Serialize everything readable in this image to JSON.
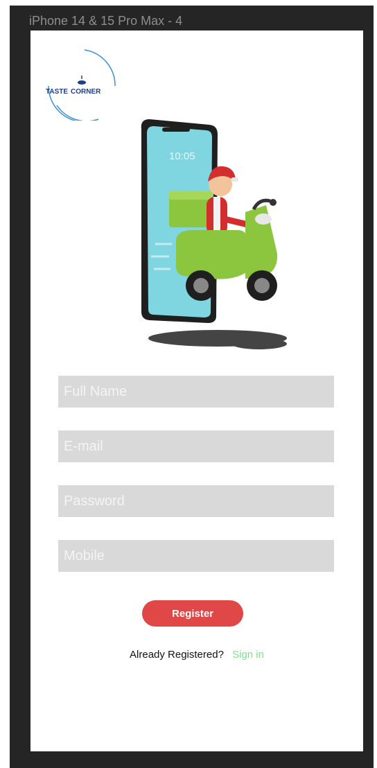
{
  "window": {
    "title": "iPhone 14 & 15 Pro Max - 4"
  },
  "logo": {
    "text_part1": "TASTE",
    "text_part2": "CORNER"
  },
  "hero": {
    "clock": "10:05"
  },
  "form": {
    "full_name_placeholder": "Full Name",
    "email_placeholder": "E-mail",
    "password_placeholder": "Password",
    "mobile_placeholder": "Mobile",
    "register_label": "Register"
  },
  "footer": {
    "prompt_text": "Already Registered?",
    "signin_label": "Sign in"
  },
  "colors": {
    "accent_register": "#e04848",
    "signin_link": "#7ee08e",
    "field_bg": "#d9d9d9",
    "canvas_bg": "#252525"
  }
}
